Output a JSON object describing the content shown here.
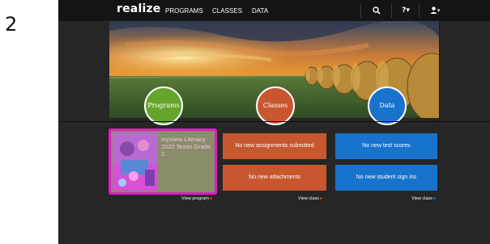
{
  "step_number": "2",
  "navbar": {
    "logo": "realize",
    "links": [
      "PROGRAMS",
      "CLASSES",
      "DATA"
    ],
    "help_label": "?▾",
    "user_label": "▾"
  },
  "sections": {
    "programs": "Programs",
    "classes": "Classes",
    "data": "Data"
  },
  "program_card": {
    "title": "myView Literacy 2020 Texas Grade 2",
    "view_label": "View program"
  },
  "class_tiles": {
    "assignments": "No new assignments submitted",
    "attachments": "No new attachments",
    "view_label": "View class"
  },
  "data_tiles": {
    "test_scores": "No new test scores",
    "sign_ins": "No new student sign ins",
    "view_label": "View class"
  },
  "colors": {
    "programs": "#66a52b",
    "classes": "#c8572f",
    "data": "#1773cc",
    "highlight": "#e11bc4"
  },
  "icons": [
    "search-icon",
    "help-icon",
    "user-icon",
    "chevron-right-icon"
  ]
}
